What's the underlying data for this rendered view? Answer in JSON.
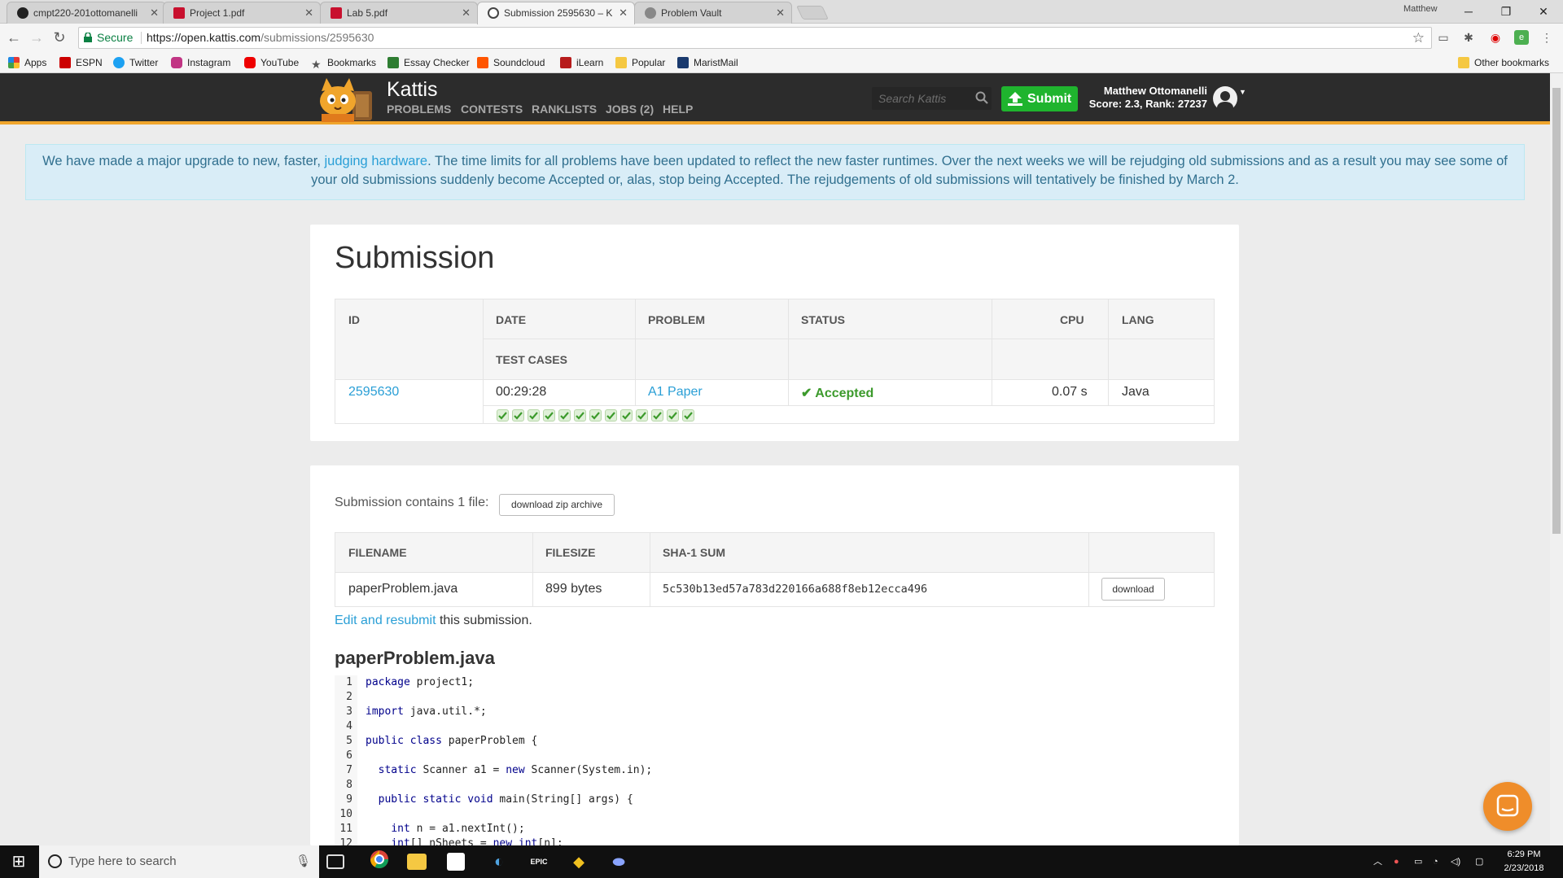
{
  "browser": {
    "tabs": [
      {
        "title": "cmpt220-201ottomanelli",
        "icon": "github-icon"
      },
      {
        "title": "Project 1.pdf",
        "icon": "pdf-icon"
      },
      {
        "title": "Lab 5.pdf",
        "icon": "pdf-icon"
      },
      {
        "title": "Submission 2595630 – K",
        "icon": "kattis-icon"
      },
      {
        "title": "Problem Vault",
        "icon": "gear-icon"
      }
    ],
    "profile_name": "Matthew",
    "secure_label": "Secure",
    "url_base": "https://open.kattis.com",
    "url_path": "/submissions/2595630",
    "bookmarks": [
      "Apps",
      "ESPN",
      "Twitter",
      "Instagram",
      "YouTube",
      "Bookmarks",
      "Essay Checker",
      "Soundcloud",
      "iLearn",
      "Popular",
      "MaristMail"
    ],
    "other_bookmarks": "Other bookmarks"
  },
  "site": {
    "name": "Kattis",
    "nav": [
      "PROBLEMS",
      "CONTESTS",
      "RANKLISTS",
      "JOBS (2)",
      "HELP"
    ],
    "search_placeholder": "Search Kattis",
    "submit_label": "Submit",
    "user_name": "Matthew Ottomanelli",
    "user_stats": "Score: 2.3, Rank: 27237"
  },
  "notice": {
    "before": "We have made a major upgrade to new, faster, ",
    "link": "judging hardware",
    "after": ". The time limits for all problems have been updated to reflect the new faster runtimes. Over the next weeks we will be rejudging old submissions and as a result you may see some of your old submissions suddenly become Accepted or, alas, stop being Accepted. The rejudgements of old submissions will tentatively be finished by March 2."
  },
  "submission": {
    "title": "Submission",
    "headers": {
      "id": "ID",
      "date": "DATE",
      "problem": "PROBLEM",
      "status": "STATUS",
      "cpu": "CPU",
      "lang": "LANG",
      "test_cases": "TEST CASES"
    },
    "id": "2595630",
    "date": "00:29:28",
    "problem": "A1 Paper",
    "status": "Accepted",
    "cpu": "0.07 s",
    "lang": "Java",
    "test_cases_passed": 13,
    "test_cases_total": 13
  },
  "files": {
    "contains_text": "Submission contains 1 file:",
    "zip_button": "download zip archive",
    "headers": {
      "filename": "FILENAME",
      "filesize": "FILESIZE",
      "sha": "SHA-1 SUM"
    },
    "rows": [
      {
        "filename": "paperProblem.java",
        "filesize": "899 bytes",
        "sha": "5c530b13ed57a783d220166a688f8eb12ecca496",
        "button": "download"
      }
    ],
    "edit_link": "Edit and resubmit",
    "edit_suffix": " this submission.",
    "code_title": "paperProblem.java",
    "code_lines": [
      "package project1;",
      "",
      "import java.util.*;",
      "",
      "public class paperProblem {",
      "",
      "  static Scanner a1 = new Scanner(System.in);",
      "",
      "  public static void main(String[] args) {",
      "",
      "    int n = a1.nextInt();",
      "    int[] nSheets = new int[n];"
    ]
  },
  "taskbar": {
    "search_placeholder": "Type here to search",
    "time": "6:29 PM",
    "date": "2/23/2018"
  },
  "colors": {
    "accent": "#f0a52c",
    "link": "#2a9fd6",
    "accepted": "#3c9a2c",
    "submit": "#1fb42e",
    "header": "#2c2c2c"
  }
}
